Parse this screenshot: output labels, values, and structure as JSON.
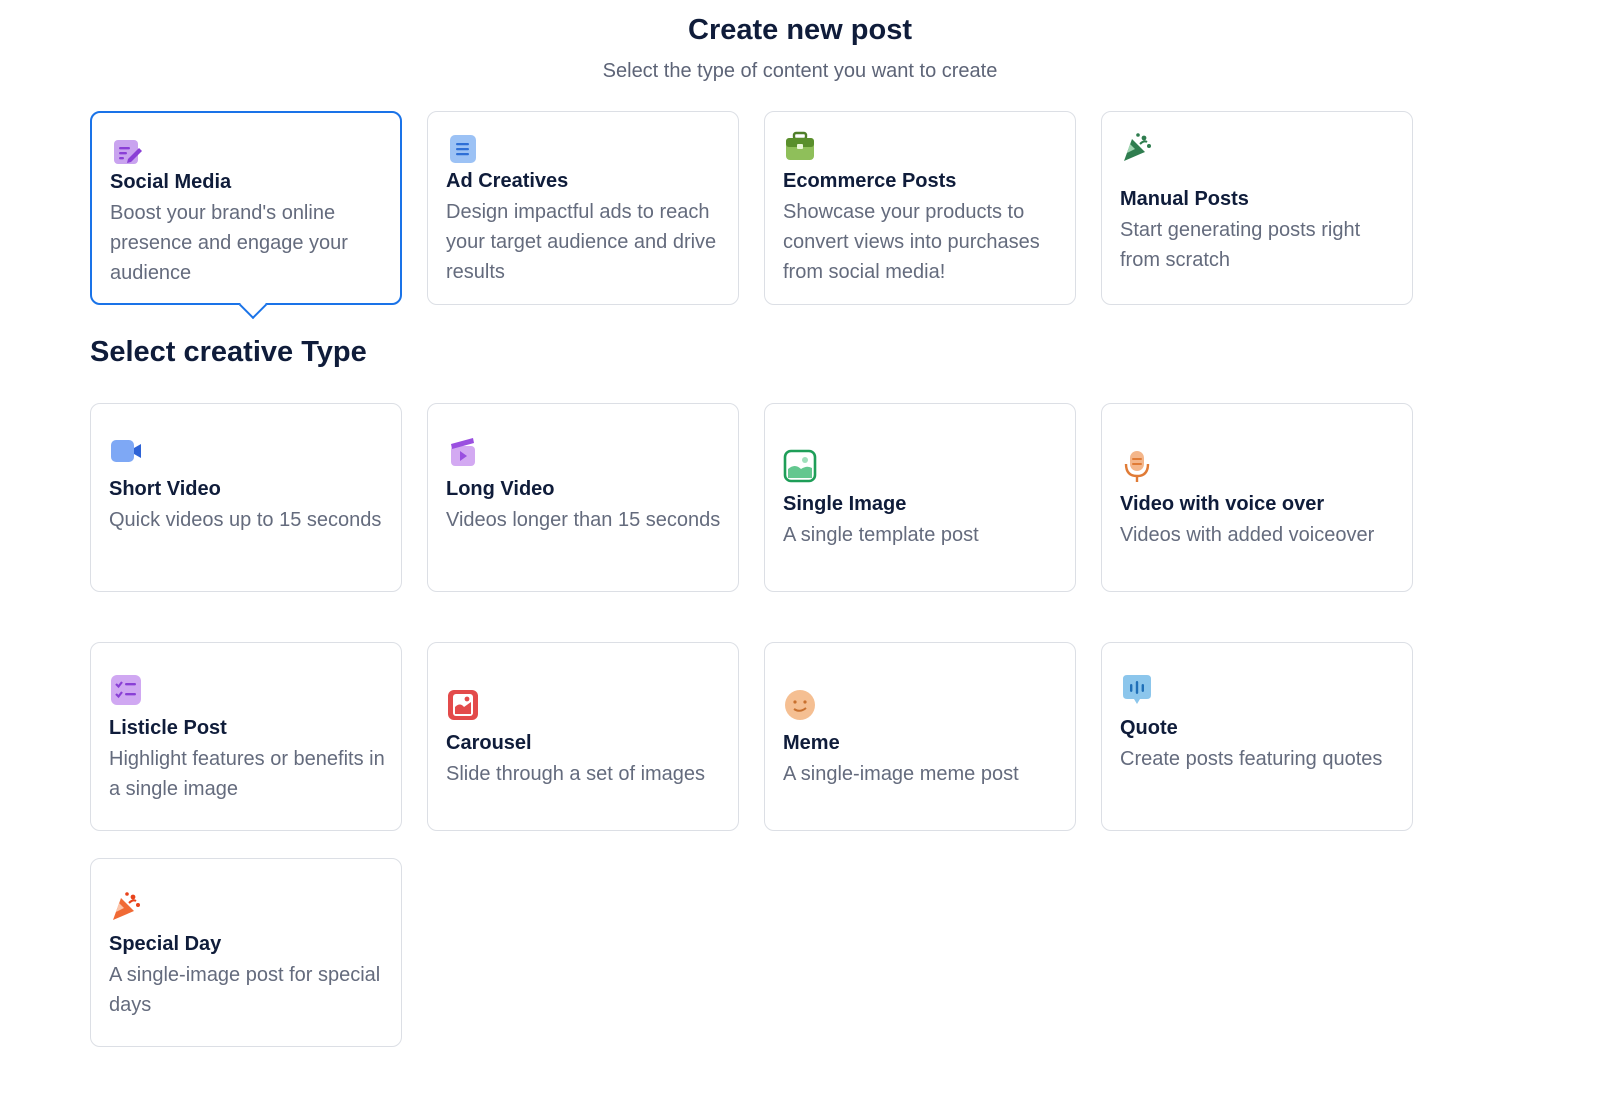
{
  "header": {
    "title": "Create new post",
    "subtitle": "Select the type of content you want to create"
  },
  "content_types": [
    {
      "title": "Social Media",
      "description": "Boost your brand's online presence and engage your audience",
      "icon": "edit-note-icon",
      "selected": true
    },
    {
      "title": "Ad Creatives",
      "description": "Design impactful ads to reach your target audience and drive results",
      "icon": "document-icon"
    },
    {
      "title": "Ecommerce Posts",
      "description": "Showcase your products to convert views into purchases from social media!",
      "icon": "shopping-bag-icon"
    },
    {
      "title": "Manual Posts",
      "description": "Start generating posts right from scratch",
      "icon": "party-popper-icon"
    }
  ],
  "section_title": "Select creative Type",
  "creative_types": [
    {
      "title": "Short Video",
      "description": "Quick videos up to 15 seconds",
      "icon": "video-camera-icon"
    },
    {
      "title": "Long Video",
      "description": "Videos longer than 15 seconds",
      "icon": "clapperboard-icon"
    },
    {
      "title": "Single Image",
      "description": "A single template post",
      "icon": "image-icon"
    },
    {
      "title": "Video with voice over",
      "description": "Videos with added voiceover",
      "icon": "microphone-icon"
    },
    {
      "title": "Listicle Post",
      "description": "Highlight features or benefits in a single image",
      "icon": "checklist-icon"
    },
    {
      "title": "Carousel",
      "description": "Slide through a set of images",
      "icon": "image-stack-icon"
    },
    {
      "title": "Meme",
      "description": "A single-image meme post",
      "icon": "smiley-face-icon"
    },
    {
      "title": "Quote",
      "description": "Create posts featuring quotes",
      "icon": "speech-bubble-icon"
    },
    {
      "title": "Special Day",
      "description": "A single-image post for special days",
      "icon": "party-popper-icon"
    }
  ],
  "colors": {
    "selected_border": "#1a73e8",
    "title_text": "#0f1c3a",
    "description_text": "#646b7d",
    "card_border": "#dcdfe5"
  }
}
